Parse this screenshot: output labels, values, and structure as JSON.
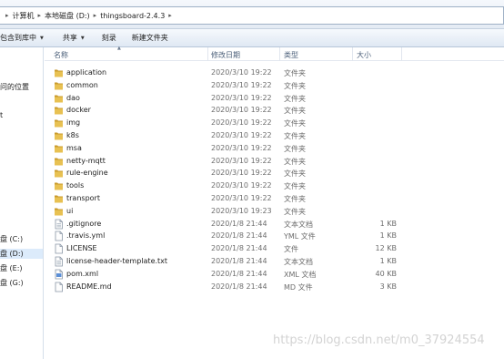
{
  "address": {
    "crumbs": [
      "计算机",
      "本地磁盘 (D:)",
      "thingsboard-2.4.3"
    ],
    "separator": "▸"
  },
  "toolbar": {
    "include_label": "包含到库中",
    "share_label": "共享",
    "burn_label": "刻录",
    "new_folder_label": "新建文件夹"
  },
  "nav": {
    "recent_places": "问的位置",
    "partial_t": "t",
    "drives": [
      "盘 (C:)",
      "盘 (D:)",
      "盘 (E:)",
      "盘 (G:)"
    ]
  },
  "columns": {
    "name": "名称",
    "modified": "修改日期",
    "type": "类型",
    "size": "大小"
  },
  "files": [
    {
      "name": "application",
      "date": "2020/3/10 19:22",
      "type": "文件夹",
      "size": "",
      "icon": "folder-icon"
    },
    {
      "name": "common",
      "date": "2020/3/10 19:22",
      "type": "文件夹",
      "size": "",
      "icon": "folder-icon"
    },
    {
      "name": "dao",
      "date": "2020/3/10 19:22",
      "type": "文件夹",
      "size": "",
      "icon": "folder-icon"
    },
    {
      "name": "docker",
      "date": "2020/3/10 19:22",
      "type": "文件夹",
      "size": "",
      "icon": "folder-icon"
    },
    {
      "name": "img",
      "date": "2020/3/10 19:22",
      "type": "文件夹",
      "size": "",
      "icon": "folder-icon"
    },
    {
      "name": "k8s",
      "date": "2020/3/10 19:22",
      "type": "文件夹",
      "size": "",
      "icon": "folder-icon"
    },
    {
      "name": "msa",
      "date": "2020/3/10 19:22",
      "type": "文件夹",
      "size": "",
      "icon": "folder-icon"
    },
    {
      "name": "netty-mqtt",
      "date": "2020/3/10 19:22",
      "type": "文件夹",
      "size": "",
      "icon": "folder-icon"
    },
    {
      "name": "rule-engine",
      "date": "2020/3/10 19:22",
      "type": "文件夹",
      "size": "",
      "icon": "folder-icon"
    },
    {
      "name": "tools",
      "date": "2020/3/10 19:22",
      "type": "文件夹",
      "size": "",
      "icon": "folder-icon"
    },
    {
      "name": "transport",
      "date": "2020/3/10 19:22",
      "type": "文件夹",
      "size": "",
      "icon": "folder-icon"
    },
    {
      "name": "ui",
      "date": "2020/3/10 19:23",
      "type": "文件夹",
      "size": "",
      "icon": "folder-icon"
    },
    {
      "name": ".gitignore",
      "date": "2020/1/8 21:44",
      "type": "文本文档",
      "size": "1 KB",
      "icon": "text-file-icon"
    },
    {
      "name": ".travis.yml",
      "date": "2020/1/8 21:44",
      "type": "YML 文件",
      "size": "1 KB",
      "icon": "file-icon"
    },
    {
      "name": "LICENSE",
      "date": "2020/1/8 21:44",
      "type": "文件",
      "size": "12 KB",
      "icon": "file-icon"
    },
    {
      "name": "license-header-template.txt",
      "date": "2020/1/8 21:44",
      "type": "文本文档",
      "size": "1 KB",
      "icon": "text-file-icon"
    },
    {
      "name": "pom.xml",
      "date": "2020/1/8 21:44",
      "type": "XML 文档",
      "size": "40 KB",
      "icon": "xml-file-icon"
    },
    {
      "name": "README.md",
      "date": "2020/1/8 21:44",
      "type": "MD 文件",
      "size": "3 KB",
      "icon": "file-icon"
    }
  ],
  "watermark": "https://blog.csdn.net/m0_37924554",
  "colors": {
    "folder": "#e8c152",
    "folder_dark": "#c99a2c",
    "header_text": "#4c607a"
  }
}
